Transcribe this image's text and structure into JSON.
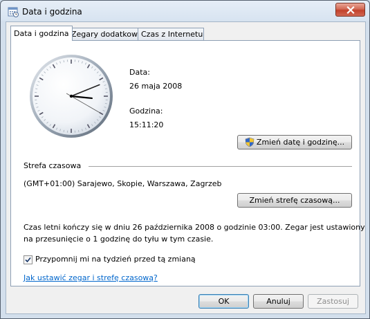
{
  "window": {
    "title": "Data i godzina",
    "icon": "calendar-clock-icon"
  },
  "tabs": [
    {
      "label": "Data i godzina",
      "active": true
    },
    {
      "label": "Zegary dodatkowe",
      "active": false
    },
    {
      "label": "Czas z Internetu",
      "active": false
    }
  ],
  "datetime": {
    "date_label": "Data:",
    "date_value": "26 maja 2008",
    "time_label": "Godzina:",
    "time_value": "15:11:20",
    "change_button": "Zmień datę i godzinę..."
  },
  "clock": {
    "hours": 15,
    "minutes": 11,
    "seconds": 20
  },
  "timezone": {
    "section_label": "Strefa czasowa",
    "value": "(GMT+01:00) Sarajewo, Skopie, Warszawa, Zagrzeb",
    "change_button": "Zmień strefę czasową..."
  },
  "dst": {
    "line1": "Czas letni kończy się w dniu 26 października 2008 o godzinie 03:00. Zegar jest ustawiony",
    "line2": "na przesunięcie o 1 godzinę do tyłu w tym czasie.",
    "reminder_label": "Przypomnij mi na tydzień przed tą zmianą",
    "reminder_checked": true
  },
  "help_link": "Jak ustawić zegar i strefę czasową?",
  "footer": {
    "ok": "OK",
    "cancel": "Anuluj",
    "apply": "Zastosuj"
  }
}
